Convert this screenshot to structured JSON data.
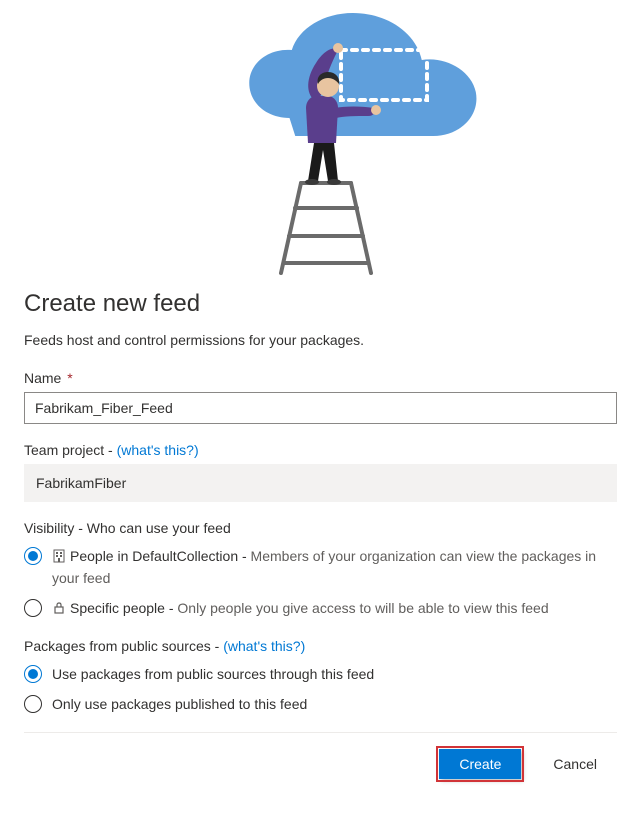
{
  "heading": "Create new feed",
  "subheading": "Feeds host and control permissions for your packages.",
  "name_field": {
    "label": "Name",
    "required_marker": "*",
    "value": "Fabrikam_Fiber_Feed"
  },
  "team_project": {
    "label": "Team project - ",
    "hint_link": "(what's this?)",
    "value": "FabrikamFiber"
  },
  "visibility": {
    "label": "Visibility - Who can use your feed",
    "options": [
      {
        "title": "People in DefaultCollection - ",
        "desc": "Members of your organization can view the packages in your feed",
        "checked": true
      },
      {
        "title": "Specific people - ",
        "desc": "Only people you give access to will be able to view this feed",
        "checked": false
      }
    ]
  },
  "public_sources": {
    "label_prefix": "Packages from public sources - ",
    "hint_link": "(what's this?)",
    "options": [
      {
        "label": "Use packages from public sources through this feed",
        "checked": true
      },
      {
        "label": "Only use packages published to this feed",
        "checked": false
      }
    ]
  },
  "buttons": {
    "create": "Create",
    "cancel": "Cancel"
  }
}
